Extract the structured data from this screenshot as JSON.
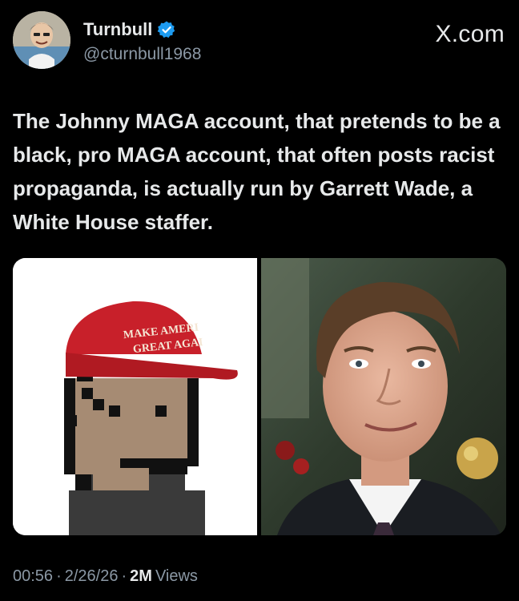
{
  "author": {
    "display_name": "Turnbull",
    "handle": "@cturnbull1968",
    "verified": true,
    "verified_color": "#1d9bf0"
  },
  "brand_label": "X.com",
  "tweet": {
    "text": "The Johnny MAGA account, that pretends to be a black, pro MAGA account, that often posts racist propaganda, is actually run by Garrett Wade, a White House staffer."
  },
  "media": {
    "left_image": {
      "hat_line1": "MAKE AMERI",
      "hat_line2": "GREAT AGAI",
      "hat_color": "#c8202a"
    }
  },
  "meta": {
    "time": "00:56",
    "date": "2/26/26",
    "views_count": "2M",
    "views_label": "Views",
    "separator": "·"
  }
}
